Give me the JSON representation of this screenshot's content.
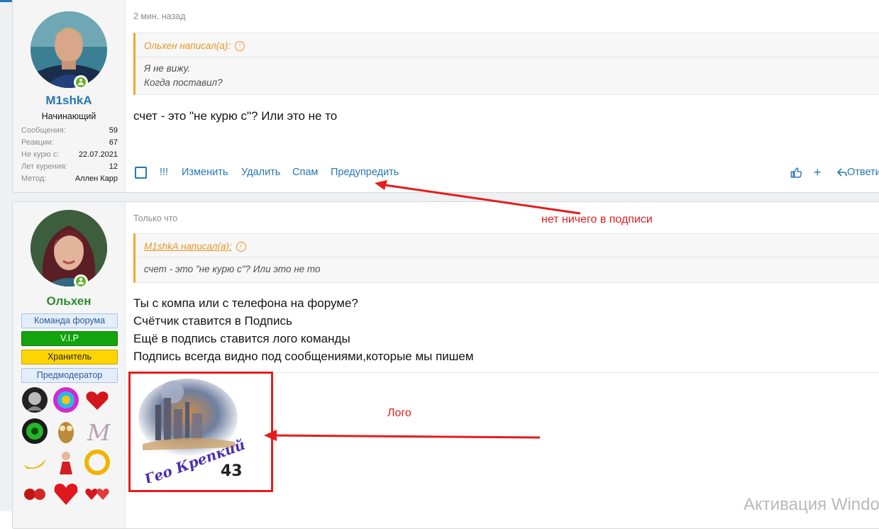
{
  "post1": {
    "user": {
      "name": "M1shkA",
      "title": "Начинающий",
      "online": true
    },
    "stats": [
      {
        "key": "Сообщения:",
        "value": "59"
      },
      {
        "key": "Реакции:",
        "value": "67"
      },
      {
        "key": "Не курю с:",
        "value": "22.07.2021"
      },
      {
        "key": "Лет курения:",
        "value": "12"
      },
      {
        "key": "Метод:",
        "value": "Аллен Карр"
      }
    ],
    "time": "2 мин. назад",
    "quote": {
      "author": "Ольхен написал(а):",
      "lines": [
        "Я не вижу.",
        "Когда поставил?"
      ]
    },
    "message": "счет - это \"не курю с\"? Или это не то",
    "actions": {
      "flag": "!!!",
      "edit": "Изменить",
      "delete": "Удалить",
      "spam": "Спам",
      "warn": "Предупредить",
      "plus": "+",
      "reply": "Ответить"
    }
  },
  "post2": {
    "user": {
      "name": "Ольхен",
      "online": true
    },
    "badges": {
      "team": "Команда форума",
      "vip": "V.I.P",
      "keeper": "Хранитель",
      "moderator": "Предмодератор"
    },
    "time": "Только что",
    "quote": {
      "author": "M1shkA написал(а):",
      "lines": [
        "счет - это \"не курю с\"? Или это не то"
      ]
    },
    "message_lines": [
      "Ты с компа или с телефона на форуме?",
      "Счётчик ставится в Подпись",
      "Ещё в подпись ставится лого команды",
      "Подпись всегда видно под сообщениями,которые мы пишем"
    ]
  },
  "annotations": {
    "no_signature": "нет ничего в подписи",
    "logo": "Лого"
  },
  "watermark": "Активация Windows",
  "colors": {
    "accent": "#2577b1",
    "quote_border": "#f1a627",
    "annotation_red": "#e51c1c",
    "green_name": "#2e8a2e"
  }
}
